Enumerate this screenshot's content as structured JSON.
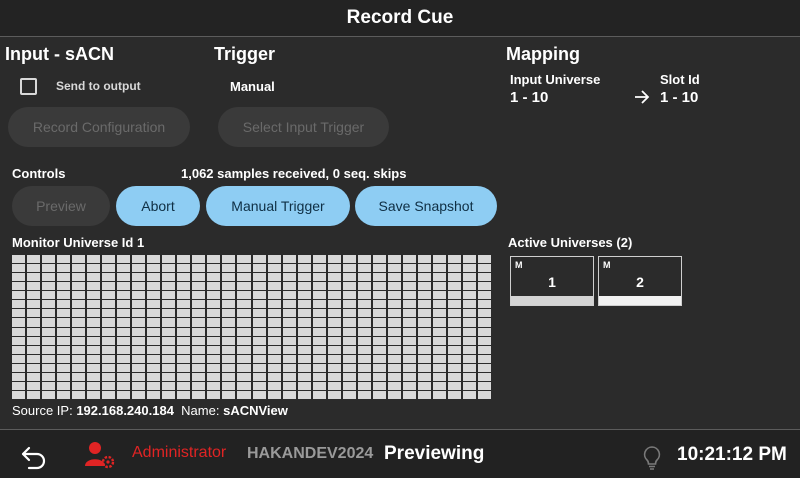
{
  "window": {
    "title": "Record Cue"
  },
  "input": {
    "heading": "Input - sACN",
    "send_to_output_label": "Send to output",
    "send_to_output_checked": false,
    "record_config_label": "Record Configuration"
  },
  "trigger": {
    "heading": "Trigger",
    "mode": "Manual",
    "select_label": "Select Input Trigger"
  },
  "mapping": {
    "heading": "Mapping",
    "input_universe_label": "Input Universe",
    "input_universe_value": "1 - 10",
    "slot_id_label": "Slot Id",
    "slot_id_value": "1 - 10",
    "arrow_icon": "arrow-right-icon"
  },
  "controls": {
    "heading": "Controls",
    "status": "1,062 samples received, 0 seq. skips",
    "preview_label": "Preview",
    "abort_label": "Abort",
    "manual_trigger_label": "Manual Trigger",
    "save_snapshot_label": "Save Snapshot"
  },
  "monitor": {
    "heading": "Monitor Universe Id 1",
    "source_ip_label": "Source IP:",
    "source_ip": "192.168.240.184",
    "name_label": "Name:",
    "name": "sACNView"
  },
  "active_universes": {
    "heading": "Active Universes (2)",
    "items": [
      {
        "badge": "M",
        "id": "1",
        "level_color": "#d4d4d4"
      },
      {
        "badge": "M",
        "id": "2",
        "level_color": "#f2f2f2"
      }
    ]
  },
  "footer": {
    "back_icon": "undo-icon",
    "user_icon": "user-settings-icon",
    "user": "Administrator",
    "device": "HAKANDEV2024",
    "state": "Previewing",
    "bulb_icon": "lightbulb-icon",
    "time": "10:21:12 PM"
  },
  "colors": {
    "accent_button": "#8ecdf3",
    "admin_red": "#e02424",
    "background": "#2b2b2b"
  }
}
